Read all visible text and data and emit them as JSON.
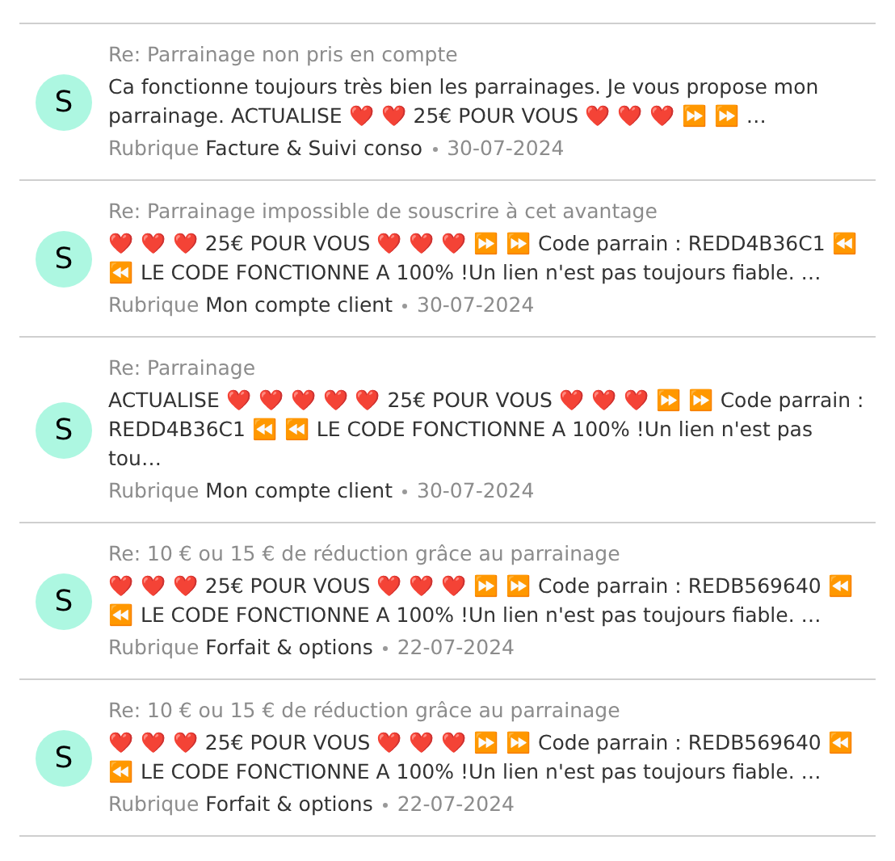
{
  "messages": [
    {
      "avatar": "S",
      "subject": "Re: Parrainage non pris en compte",
      "excerpt": "Ca fonctionne toujours très bien les parrainages. Je vous propose mon parrainage. ACTUALISE ❤️ ❤️  25€ POUR VOUS ❤️ ❤️ ❤️ ⏩ ⏩ …",
      "rubrique_label": "Rubrique",
      "rubrique": "Facture & Suivi conso",
      "date": "30-07-2024"
    },
    {
      "avatar": "S",
      "subject": "Re: Parrainage impossible de souscrire à cet avantage",
      "excerpt": "❤️ ❤️ ❤️  25€ POUR VOUS ❤️ ❤️ ❤️ ⏩ ⏩  Code parrain : REDD4B36C1 ⏪ ⏪ LE CODE FONCTIONNE A 100% !Un lien n'est pas toujours fiable. …",
      "rubrique_label": "Rubrique",
      "rubrique": "Mon compte client",
      "date": "30-07-2024"
    },
    {
      "avatar": "S",
      "subject": "Re: Parrainage",
      "excerpt": "ACTUALISE ❤️ ❤️ ❤️ ❤️ ❤️  25€ POUR VOUS ❤️ ❤️ ❤️ ⏩ ⏩  Code parrain : REDD4B36C1 ⏪ ⏪ LE CODE FONCTIONNE A 100% !Un lien n'est pas tou…",
      "rubrique_label": "Rubrique",
      "rubrique": "Mon compte client",
      "date": "30-07-2024"
    },
    {
      "avatar": "S",
      "subject": "Re: 10 € ou 15 € de réduction grâce au parrainage",
      "excerpt": "❤️ ❤️ ❤️  25€ POUR VOUS ❤️ ❤️ ❤️ ⏩ ⏩  Code parrain : REDB569640 ⏪ ⏪ LE CODE FONCTIONNE A 100% !Un lien n'est pas toujours fiable. …",
      "rubrique_label": "Rubrique",
      "rubrique": "Forfait & options",
      "date": "22-07-2024"
    },
    {
      "avatar": "S",
      "subject": "Re: 10 € ou 15 € de réduction grâce au parrainage",
      "excerpt": "❤️ ❤️ ❤️  25€ POUR VOUS ❤️ ❤️ ❤️ ⏩ ⏩  Code parrain : REDB569640 ⏪ ⏪ LE CODE FONCTIONNE A 100% !Un lien n'est pas toujours fiable. …",
      "rubrique_label": "Rubrique",
      "rubrique": "Forfait & options",
      "date": "22-07-2024"
    }
  ]
}
